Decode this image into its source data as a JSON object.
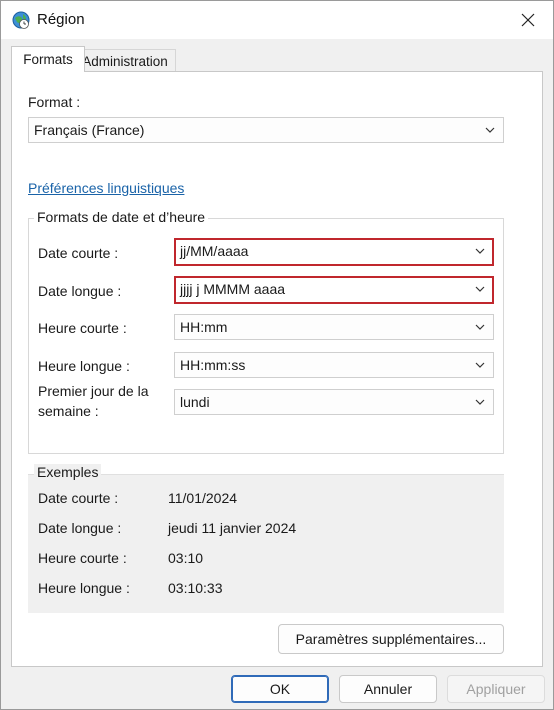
{
  "window": {
    "title": "Région"
  },
  "tabs": [
    {
      "label": "Formats",
      "active": true
    },
    {
      "label": "Administration",
      "active": false
    }
  ],
  "format": {
    "label": "Format :",
    "value": "Français (France)"
  },
  "language_link": "Préférences linguistiques",
  "date_time_formats": {
    "group_title": "Formats de date et d’heure",
    "short_date_label": "Date courte :",
    "short_date_value": "jj/MM/aaaa",
    "long_date_label": "Date longue :",
    "long_date_value": "jjjj j MMMM aaaa",
    "short_time_label": "Heure courte :",
    "short_time_value": "HH:mm",
    "long_time_label": "Heure longue :",
    "long_time_value": "HH:mm:ss",
    "first_day_label_line1": "Premier jour de la",
    "first_day_label_line2": "semaine :",
    "first_day_value": "lundi"
  },
  "examples": {
    "group_title": "Exemples",
    "rows": [
      {
        "label": "Date courte :",
        "value": "11/01/2024"
      },
      {
        "label": "Date longue :",
        "value": "jeudi 11 janvier 2024"
      },
      {
        "label": "Heure courte :",
        "value": "03:10"
      },
      {
        "label": "Heure longue :",
        "value": "03:10:33"
      }
    ]
  },
  "additional_settings_button": "Paramètres supplémentaires...",
  "footer": {
    "ok": "OK",
    "cancel": "Annuler",
    "apply": "Appliquer"
  },
  "colors": {
    "highlight_border": "#c0272d",
    "link": "#1a63a8",
    "primary_border": "#2f6ab8"
  }
}
